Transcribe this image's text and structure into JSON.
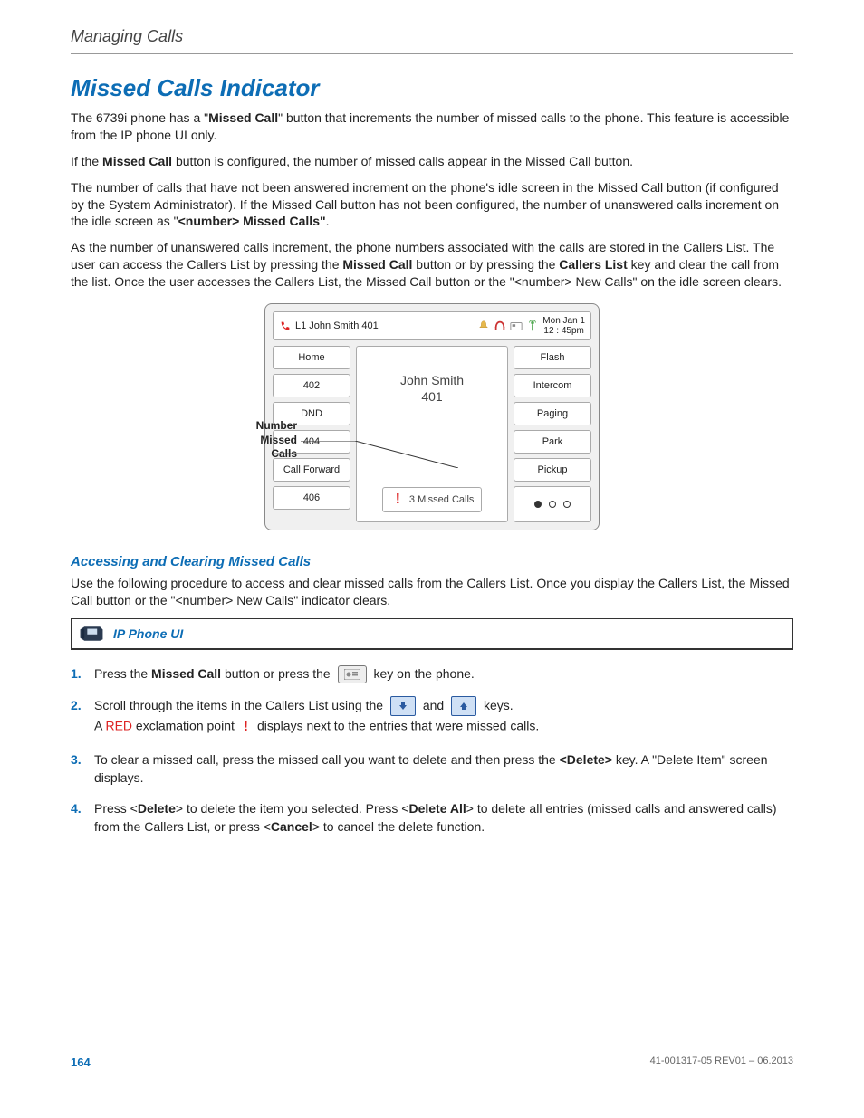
{
  "header": {
    "title": "Managing Calls"
  },
  "h1": "Missed Calls Indicator",
  "p1_a": "The 6739i phone has a \"",
  "p1_b": "Missed Call",
  "p1_c": "\" button that increments the number of missed calls to the phone. This feature is accessible from the IP phone UI only.",
  "p2_a": "If the ",
  "p2_b": "Missed Call",
  "p2_c": " button is configured, the number of missed calls appear in the Missed Call button.",
  "p3_a": "The number of calls that have not been answered increment on the phone's idle screen in the Missed Call button (if configured by the System Administrator). If the Missed Call button has not been configured, the number of unanswered calls increment on the idle screen as \"",
  "p3_b": "<number> Missed Calls\"",
  "p3_c": ".",
  "p4_a": "As the number of unanswered calls increment, the phone numbers associated with the calls are stored in the Callers List. The user can access the Callers List by pressing the ",
  "p4_b": "Missed Call",
  "p4_c": " button or by pressing the ",
  "p4_d": "Callers List",
  "p4_e": " key and clear the call from the list. Once the user accesses the Callers List, the Missed Call button or the \"<number> New Calls\" on the idle screen clears.",
  "callout": "Number Missed Calls",
  "phone": {
    "status_line": "L1 John Smith 401",
    "date": "Mon Jan 1",
    "time": "12 : 45pm",
    "left_keys": [
      "Home",
      "402",
      "DND",
      "404",
      "Call Forward",
      "406"
    ],
    "right_keys": [
      "Flash",
      "Intercom",
      "Paging",
      "Park",
      "Pickup"
    ],
    "center_name": "John Smith",
    "center_ext": "401",
    "missed": "3 Missed Calls"
  },
  "sub_h": "Accessing and Clearing Missed Calls",
  "p5": "Use the following procedure to access and clear missed calls from the Callers List. Once you display the Callers List, the Missed Call button or the \"<number> New Calls\" indicator clears.",
  "ui_bar": "IP Phone UI",
  "steps": {
    "s1_a": "Press the ",
    "s1_b": "Missed Call",
    "s1_c": " button or press the ",
    "s1_d": " key on the phone.",
    "s2_a": "Scroll through the items in the Callers List using the ",
    "s2_b": " and ",
    "s2_c": " keys.",
    "s2_d": "A ",
    "s2_e": "RED",
    "s2_f": " exclamation point ",
    "s2_g": " displays next to the entries that were missed calls.",
    "s3_a": "To clear a missed call, press the missed call you want to delete and then press the ",
    "s3_b": "<Delete>",
    "s3_c": " key. A \"Delete Item\" screen displays.",
    "s4_a": "Press <",
    "s4_b": "Delete",
    "s4_c": "> to delete the item you selected. Press <",
    "s4_d": "Delete All",
    "s4_e": "> to delete all entries (missed calls and answered calls) from the Callers List, or press <",
    "s4_f": "Cancel",
    "s4_g": "> to cancel the delete function."
  },
  "footer": {
    "page": "164",
    "rev": "41-001317-05 REV01 – 06.2013"
  }
}
